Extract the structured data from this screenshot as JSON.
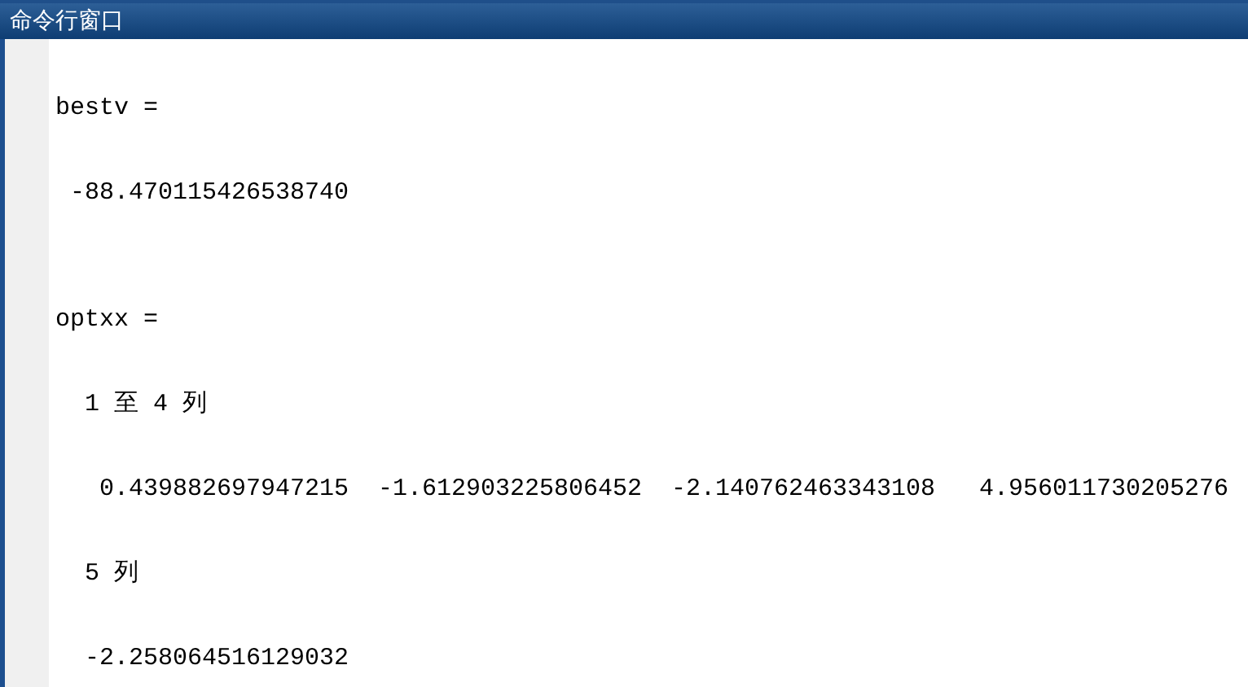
{
  "window": {
    "title": "命令行窗口"
  },
  "lines": [
    {
      "kind": "blank"
    },
    {
      "kind": "label",
      "text": "bestv ="
    },
    {
      "kind": "blank"
    },
    {
      "kind": "values",
      "values": [
        "-88.470115426538740"
      ]
    },
    {
      "kind": "blank"
    },
    {
      "kind": "blank"
    },
    {
      "kind": "label",
      "text": "optxx ="
    },
    {
      "kind": "blank"
    },
    {
      "kind": "header",
      "text": "1 至 4 列"
    },
    {
      "kind": "blank"
    },
    {
      "kind": "values",
      "values": [
        "0.439882697947215",
        "-1.612903225806452",
        "-2.140762463343108",
        "4.956011730205276"
      ]
    },
    {
      "kind": "blank"
    },
    {
      "kind": "header",
      "text": "5 列"
    },
    {
      "kind": "blank"
    },
    {
      "kind": "values",
      "values": [
        "-2.258064516129032"
      ]
    }
  ]
}
